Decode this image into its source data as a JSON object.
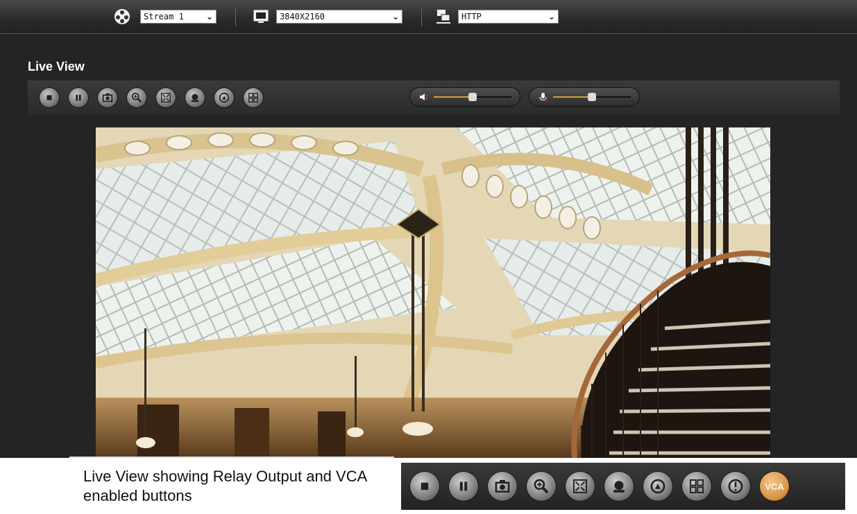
{
  "toolbar_top": {
    "stream": {
      "icon": "reel-icon",
      "value": "Stream 1"
    },
    "resolution": {
      "icon": "monitor-icon",
      "value": "3840X2160"
    },
    "protocol": {
      "icon": "network-icon",
      "value": "HTTP"
    }
  },
  "live_view": {
    "title": "Live View",
    "controls": [
      {
        "name": "stop",
        "icon": "stop-icon"
      },
      {
        "name": "pause",
        "icon": "pause-icon"
      },
      {
        "name": "snapshot",
        "icon": "camera-icon"
      },
      {
        "name": "zoom",
        "icon": "magnifier-icon"
      },
      {
        "name": "fullscreen",
        "icon": "fullscreen-icon"
      },
      {
        "name": "record",
        "icon": "record-icon"
      },
      {
        "name": "focus",
        "icon": "focus-icon"
      },
      {
        "name": "layout",
        "icon": "grid-icon"
      }
    ],
    "speaker_volume": 0.5,
    "microphone_volume": 0.5
  },
  "caption": "Live View showing Relay Output and VCA enabled buttons",
  "enabled_buttons": {
    "buttons": [
      {
        "name": "stop",
        "icon": "stop-icon"
      },
      {
        "name": "pause",
        "icon": "pause-icon"
      },
      {
        "name": "snapshot",
        "icon": "camera-icon"
      },
      {
        "name": "zoom",
        "icon": "magnifier-icon"
      },
      {
        "name": "fullscreen",
        "icon": "fullscreen-icon"
      },
      {
        "name": "record",
        "icon": "record-icon"
      },
      {
        "name": "focus",
        "icon": "focus-icon"
      },
      {
        "name": "layout",
        "icon": "grid-icon"
      },
      {
        "name": "relay-output",
        "icon": "exclamation-icon"
      }
    ],
    "vca_label": "VCA"
  }
}
